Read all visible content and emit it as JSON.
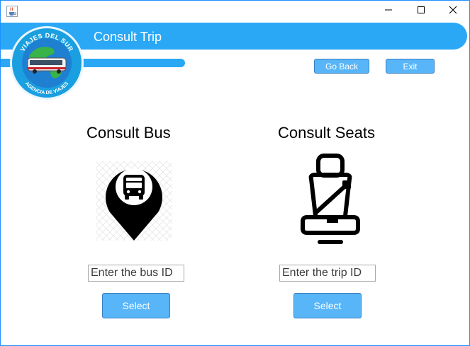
{
  "window": {
    "icons": {
      "app": "java-cup-icon",
      "minimize": "minimize-icon",
      "maximize": "maximize-icon",
      "close": "close-icon"
    }
  },
  "header": {
    "title": "Consult Trip",
    "logo": {
      "top_text": "VIAJES DEL SUR",
      "bottom_text": "AGENCIA DE VIAJES"
    },
    "go_back_label": "Go Back",
    "exit_label": "Exit"
  },
  "bus_panel": {
    "heading": "Consult Bus",
    "icon": "bus-location-pin-icon",
    "input_placeholder": "Enter the bus ID",
    "select_label": "Select"
  },
  "seats_panel": {
    "heading": "Consult Seats",
    "icon": "seat-with-seatbelt-icon",
    "input_placeholder": "Enter the trip ID",
    "select_label": "Select"
  },
  "colors": {
    "accent": "#2aa8f5",
    "button": "#58b5f8",
    "button_border": "#3a7fc0",
    "window_border": "#1e90ff"
  }
}
